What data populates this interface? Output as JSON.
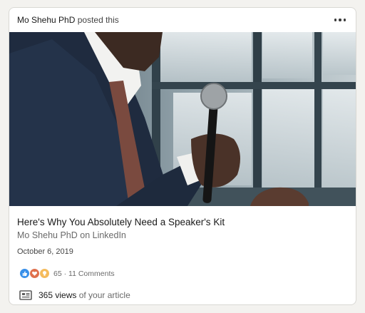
{
  "header": {
    "actor_name": "Mo Shehu PhD",
    "action_text": "posted this"
  },
  "icons": {
    "more": "more-options-icon",
    "like": "like-reaction-icon",
    "love": "love-reaction-icon",
    "insightful": "insightful-reaction-icon",
    "views": "article-views-icon"
  },
  "article": {
    "title": "Here's Why You Absolutely Need a Speaker's Kit",
    "subtitle": "Mo Shehu PhD on LinkedIn",
    "date": "October 6, 2019"
  },
  "social": {
    "reaction_count": "65",
    "separator": " · ",
    "comments": "11 Comments"
  },
  "views": {
    "count": "365 views",
    "suffix": " of your article"
  },
  "colors": {
    "background": "#f3f2ef",
    "card": "#ffffff",
    "like": "#378fe9",
    "love": "#df704d",
    "insightful": "#f5bb5c"
  }
}
